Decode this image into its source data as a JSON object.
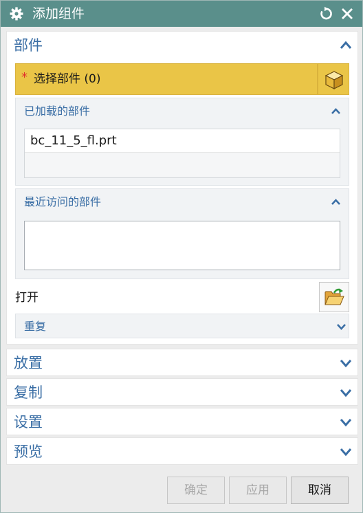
{
  "window": {
    "title": "添加组件"
  },
  "sections": {
    "parts": {
      "title": "部件",
      "select": {
        "required_mark": "*",
        "label": "选择部件 (0)"
      },
      "loaded_parts": {
        "title": "已加载的部件",
        "items": [
          "bc_11_5_fl.prt"
        ]
      },
      "recent_parts": {
        "title": "最近访问的部件"
      },
      "open_label": "打开",
      "repeat_label": "重复"
    },
    "placement": {
      "title": "放置"
    },
    "copy": {
      "title": "复制"
    },
    "settings": {
      "title": "设置"
    },
    "preview": {
      "title": "预览"
    }
  },
  "buttons": {
    "ok": "确定",
    "apply": "应用",
    "cancel": "取消"
  },
  "colors": {
    "title_bar": "#5a8f8b",
    "section_title": "#3a6ea5",
    "selection_highlight": "#eac547",
    "required_mark": "#e0302c"
  },
  "icons": {
    "title_bar": [
      "gear-icon",
      "reset-icon",
      "close-icon"
    ],
    "select_parts": "cube-icon",
    "open": "open-folder-icon"
  }
}
